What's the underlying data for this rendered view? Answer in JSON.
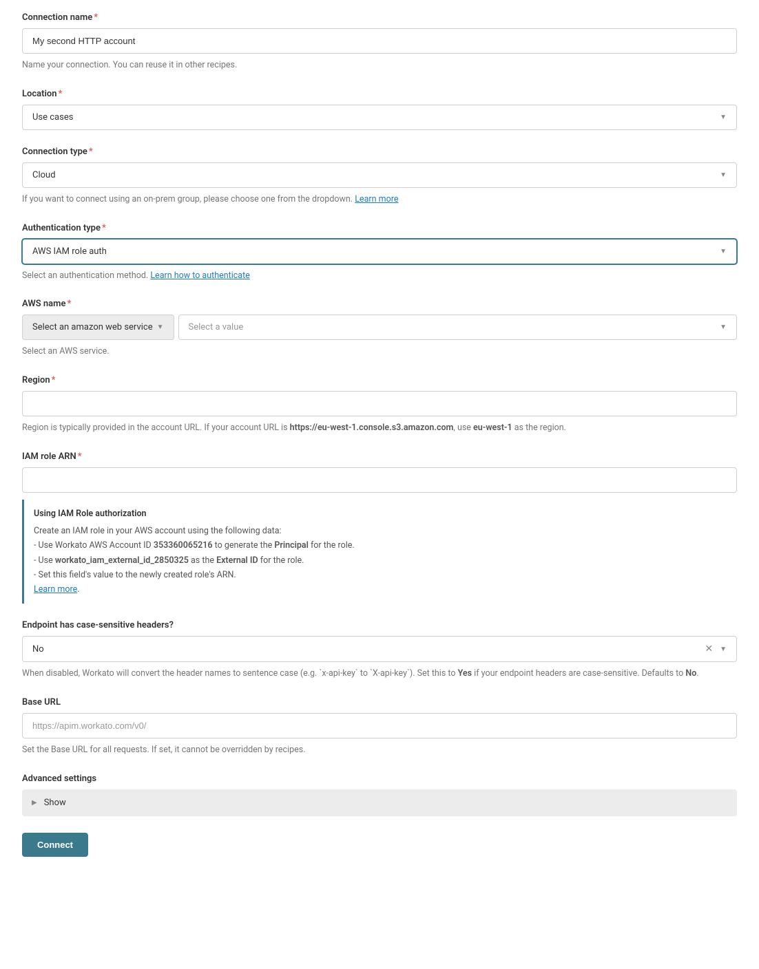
{
  "connectionName": {
    "label": "Connection name",
    "value": "My second HTTP account",
    "help": "Name your connection. You can reuse it in other recipes."
  },
  "location": {
    "label": "Location",
    "value": "Use cases"
  },
  "connectionType": {
    "label": "Connection type",
    "value": "Cloud",
    "helpPrefix": "If you want to connect using an on-prem group, please choose one from the dropdown. ",
    "helpLink": "Learn more"
  },
  "authType": {
    "label": "Authentication type",
    "value": "AWS IAM role auth",
    "helpPrefix": "Select an authentication method. ",
    "helpLink": "Learn how to authenticate"
  },
  "awsName": {
    "label": "AWS name",
    "serviceBtn": "Select an amazon web service",
    "valuePlaceholder": "Select a value",
    "help": "Select an AWS service."
  },
  "region": {
    "label": "Region",
    "helpPrefix": "Region is typically provided in the account URL. If your account URL is ",
    "helpBold1": "https://eu-west-1.console.s3.amazon.com",
    "helpMid": ", use ",
    "helpBold2": "eu-west-1",
    "helpSuffix": " as the region."
  },
  "iamRole": {
    "label": "IAM role ARN",
    "infoTitle": "Using IAM Role authorization",
    "infoLine1": "Create an IAM role in your AWS account using the following data:",
    "infoLine2a": " - Use Workato AWS Account ID ",
    "infoLine2b": "353360065216",
    "infoLine2c": " to generate the ",
    "infoLine2d": "Principal",
    "infoLine2e": " for the role.",
    "infoLine3a": " - Use ",
    "infoLine3b": "workato_iam_external_id_2850325",
    "infoLine3c": " as the ",
    "infoLine3d": "External ID",
    "infoLine3e": " for the role.",
    "infoLine4": " - Set this field's value to the newly created role's ARN.",
    "infoLink": "Learn more"
  },
  "caseSensitive": {
    "label": "Endpoint has case-sensitive headers?",
    "value": "No",
    "helpPrefix": "When disabled, Workato will convert the header names to sentence case (e.g. `x-api-key` to `X-api-key`). Set this to ",
    "helpBold1": "Yes",
    "helpMid": " if your endpoint headers are case-sensitive. Defaults to ",
    "helpBold2": "No",
    "helpSuffix": "."
  },
  "baseUrl": {
    "label": "Base URL",
    "placeholder": "https://apim.workato.com/v0/",
    "help": "Set the Base URL for all requests. If set, it cannot be overridden by recipes."
  },
  "advanced": {
    "label": "Advanced settings",
    "show": "Show"
  },
  "connectBtn": "Connect"
}
